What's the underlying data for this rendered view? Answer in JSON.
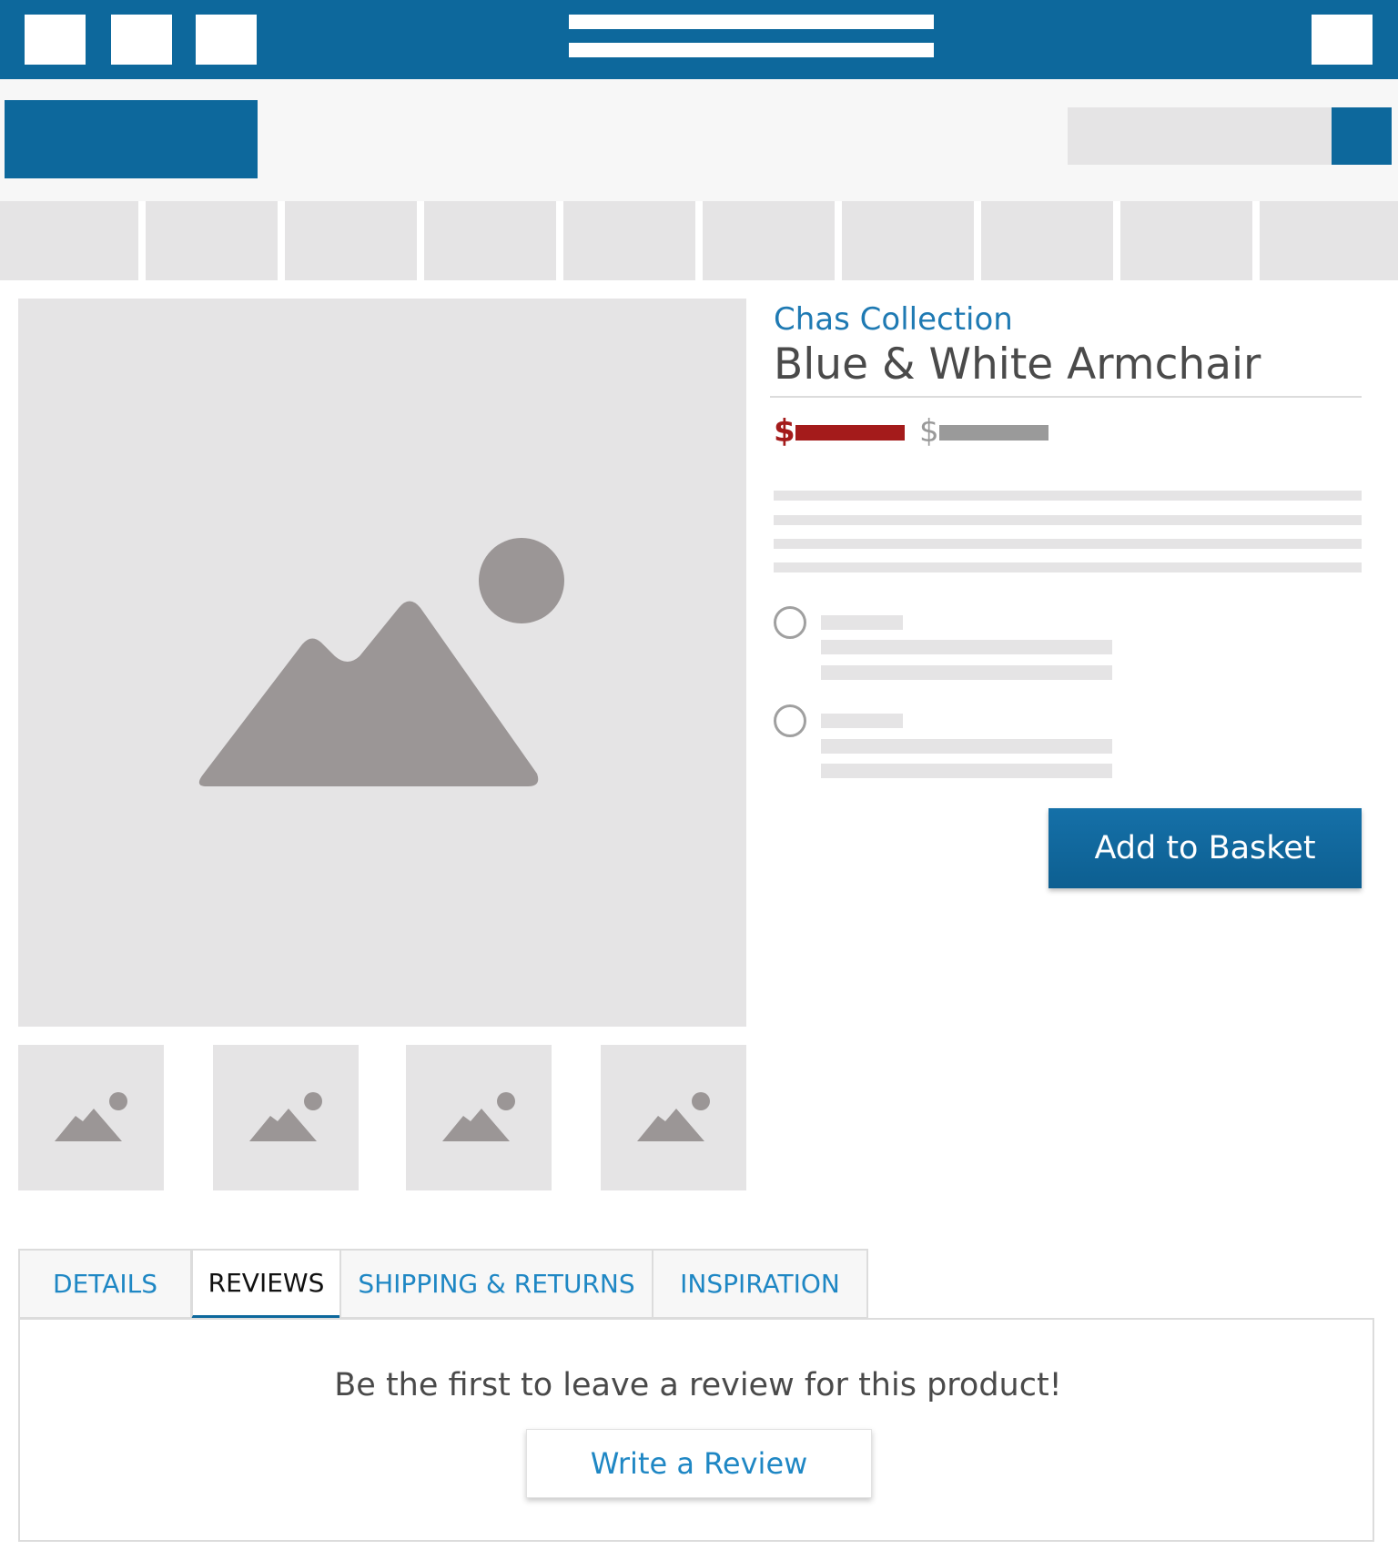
{
  "colors": {
    "brand_blue": "#0d689c",
    "link_blue": "#1f87c4",
    "sale_red": "#a41b1b",
    "placeholder_gray": "#e5e4e5",
    "icon_gray": "#9b9696"
  },
  "product": {
    "collection": "Chas Collection",
    "title": "Blue & White Armchair",
    "sale_price_symbol": "$",
    "original_price_symbol": "$",
    "add_to_basket_label": "Add to Basket"
  },
  "icons": {
    "main_image": "image-placeholder-icon",
    "thumbnail": "image-placeholder-icon",
    "menu": "hamburger-menu-icon"
  },
  "tabs": [
    {
      "label": "DETAILS"
    },
    {
      "label": "REVIEWS"
    },
    {
      "label": "SHIPPING & RETURNS"
    },
    {
      "label": "INSPIRATION"
    }
  ],
  "active_tab": "REVIEWS",
  "reviews": {
    "empty_message": "Be the first to leave a review for this product!",
    "write_review_label": "Write a Review"
  }
}
